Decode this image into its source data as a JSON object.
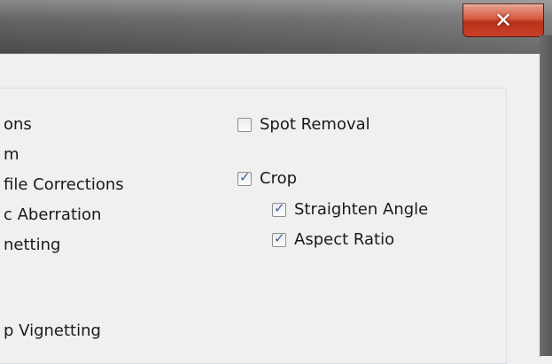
{
  "window": {
    "close_label": "✕",
    "close_color": "#c84027"
  },
  "left_column": [
    "ons",
    "m",
    "file Corrections",
    "c Aberration",
    "netting",
    "p Vignetting"
  ],
  "right_column": {
    "spot_removal": {
      "label": "Spot Removal",
      "checked": false
    },
    "crop": {
      "label": "Crop",
      "checked": true
    },
    "straighten_angle": {
      "label": "Straighten Angle",
      "checked": true
    },
    "aspect_ratio": {
      "label": "Aspect Ratio",
      "checked": true
    }
  }
}
